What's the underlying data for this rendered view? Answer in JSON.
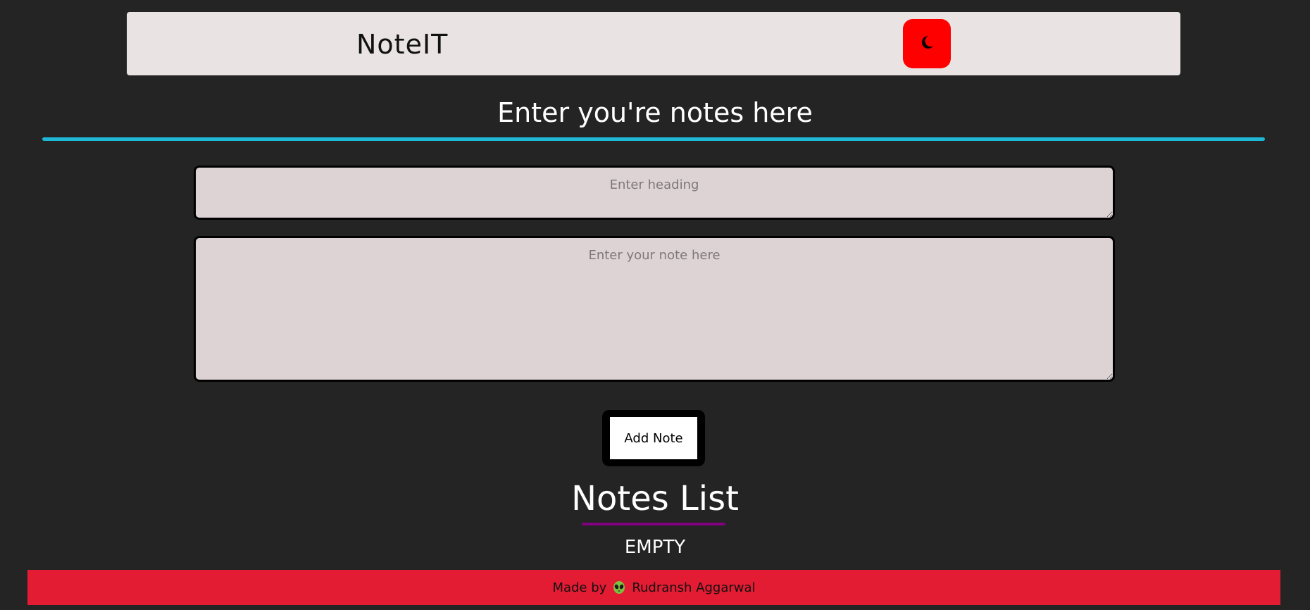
{
  "navbar": {
    "brand": "NoteIT",
    "theme_toggle_icon": "moon-icon",
    "theme_toggle_color": "#ff0000"
  },
  "editor": {
    "title": "Enter you're notes here",
    "heading_placeholder": "Enter heading",
    "note_placeholder": "Enter your note here",
    "add_button_label": "Add Note"
  },
  "notes": {
    "title": "Notes List",
    "empty_text": "EMPTY"
  },
  "footer": {
    "prefix": "Made by",
    "icon": "alien-icon",
    "author": "Rudransh Aggarwal",
    "color": "#e31b33"
  },
  "colors": {
    "background": "#242424",
    "accent_line": "#1eb8d6",
    "list_underline": "#800080"
  }
}
